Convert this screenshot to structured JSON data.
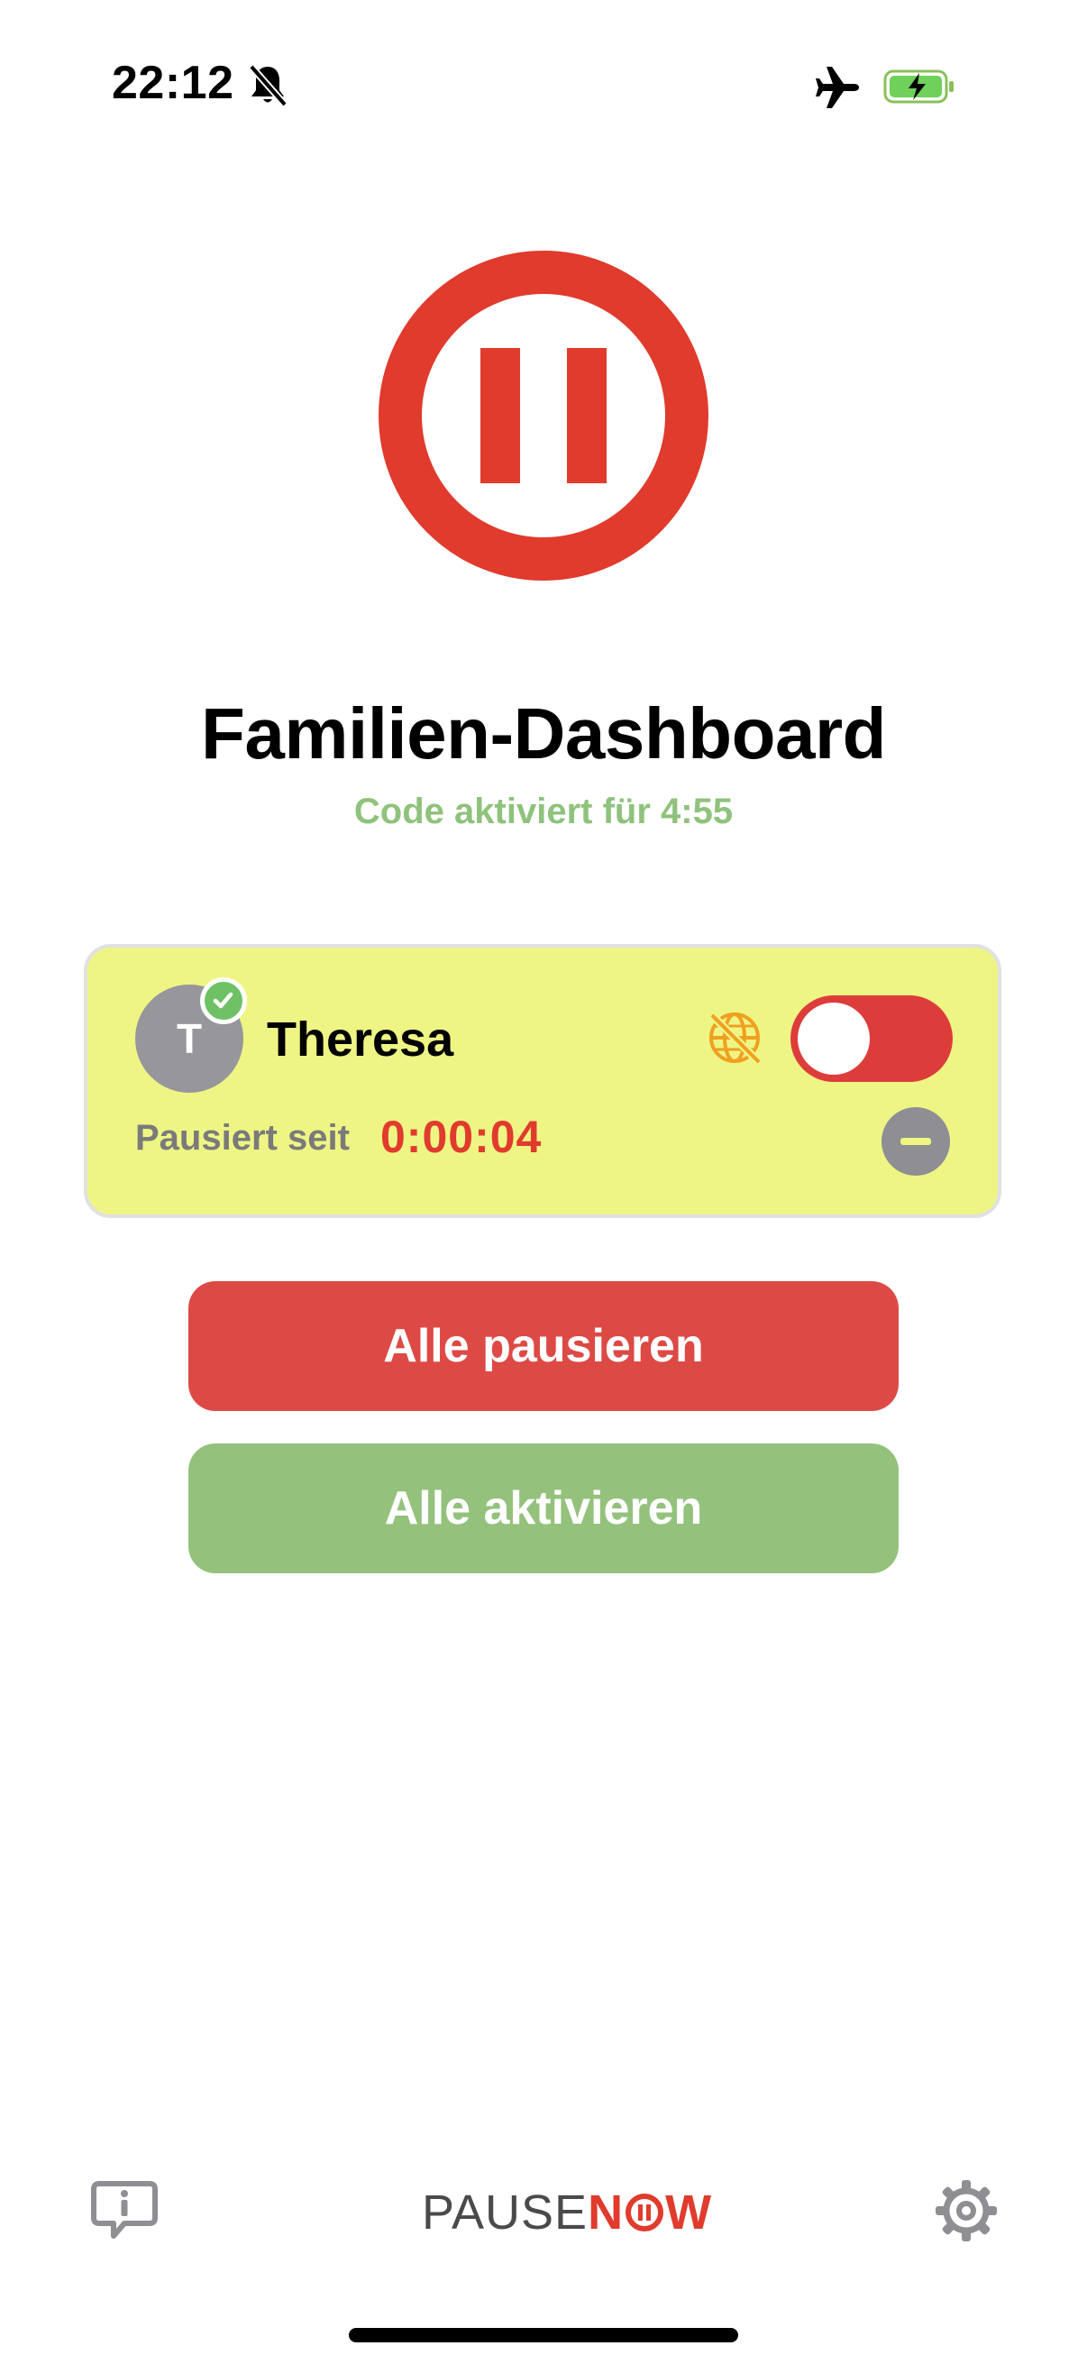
{
  "status_bar": {
    "time": "22:12",
    "icons": [
      "bell-slash-icon",
      "airplane-icon",
      "battery-charging-icon"
    ]
  },
  "logo": {
    "icon": "pause-circle-icon",
    "color": "#e03b2d"
  },
  "header": {
    "title": "Familien-Dashboard",
    "subtitle": "Code aktiviert für 4:55"
  },
  "children": [
    {
      "initial": "T",
      "name": "Theresa",
      "verified": true,
      "internet_icon": "globe-off-icon",
      "toggle_on": true,
      "paused_label": "Pausiert seit",
      "paused_timer": "0:00:04",
      "card_color": "#eef584"
    }
  ],
  "actions": {
    "pause_all": "Alle pausieren",
    "activate_all": "Alle aktivieren"
  },
  "bottom_bar": {
    "brand_left": "PAUSE",
    "brand_right_n": "N",
    "brand_right_w": "W",
    "info_icon": "info-bubble-icon",
    "settings_icon": "gear-icon"
  },
  "colors": {
    "red": "#dd4a45",
    "green": "#94c27d",
    "subtitle_green": "#8fc27c"
  }
}
